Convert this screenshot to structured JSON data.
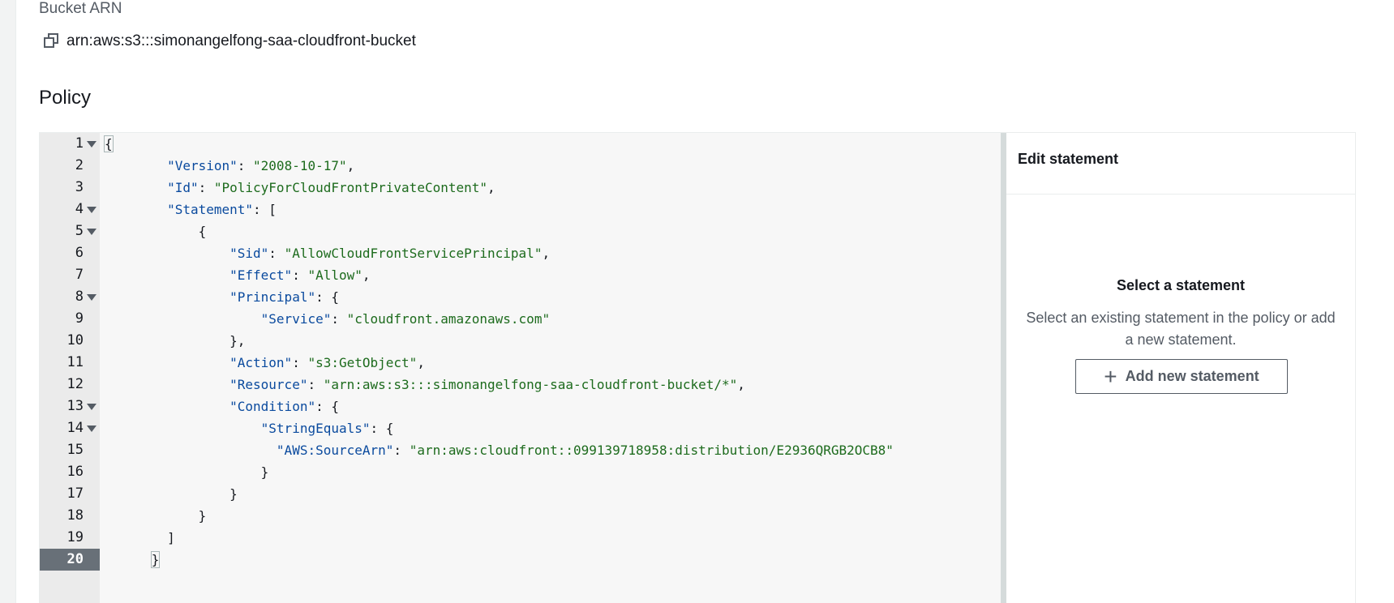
{
  "bucket_arn": {
    "label": "Bucket ARN",
    "value": "arn:aws:s3:::simonangelfong-saa-cloudfront-bucket",
    "copy_icon": "copy-icon"
  },
  "policy": {
    "title": "Policy",
    "active_line": 20,
    "lines": [
      {
        "n": "1",
        "fold": true
      },
      {
        "n": "2",
        "fold": false
      },
      {
        "n": "3",
        "fold": false
      },
      {
        "n": "4",
        "fold": true
      },
      {
        "n": "5",
        "fold": true
      },
      {
        "n": "6",
        "fold": false
      },
      {
        "n": "7",
        "fold": false
      },
      {
        "n": "8",
        "fold": true
      },
      {
        "n": "9",
        "fold": false
      },
      {
        "n": "10",
        "fold": false
      },
      {
        "n": "11",
        "fold": false
      },
      {
        "n": "12",
        "fold": false
      },
      {
        "n": "13",
        "fold": true
      },
      {
        "n": "14",
        "fold": true
      },
      {
        "n": "15",
        "fold": false
      },
      {
        "n": "16",
        "fold": false
      },
      {
        "n": "17",
        "fold": false
      },
      {
        "n": "18",
        "fold": false
      },
      {
        "n": "19",
        "fold": false
      },
      {
        "n": "20",
        "fold": false
      }
    ],
    "code": {
      "l1": "{",
      "l2_key": "\"Version\"",
      "l2_val": "\"2008-10-17\"",
      "l3_key": "\"Id\"",
      "l3_val": "\"PolicyForCloudFrontPrivateContent\"",
      "l4_key": "\"Statement\"",
      "l4_rest": ": [",
      "l5": "{",
      "l6_key": "\"Sid\"",
      "l6_val": "\"AllowCloudFrontServicePrincipal\"",
      "l7_key": "\"Effect\"",
      "l7_val": "\"Allow\"",
      "l8_key": "\"Principal\"",
      "l8_rest": ": {",
      "l9_key": "\"Service\"",
      "l9_val": "\"cloudfront.amazonaws.com\"",
      "l10": "},",
      "l11_key": "\"Action\"",
      "l11_val": "\"s3:GetObject\"",
      "l12_key": "\"Resource\"",
      "l12_val": "\"arn:aws:s3:::simonangelfong-saa-cloudfront-bucket/*\"",
      "l13_key": "\"Condition\"",
      "l13_rest": ": {",
      "l14_key": "\"StringEquals\"",
      "l14_rest": ": {",
      "l15_key": "\"AWS:SourceArn\"",
      "l15_val": "\"arn:aws:cloudfront::099139718958:distribution/E2936QRGB2OCB8\"",
      "l16": "}",
      "l17": "}",
      "l18": "}",
      "l19": "]",
      "l20": "}"
    }
  },
  "side_panel": {
    "header": "Edit statement",
    "empty_title": "Select a statement",
    "empty_desc": "Select an existing statement in the policy or add a new statement.",
    "add_button": "Add new statement",
    "add_icon": "plus-icon"
  }
}
